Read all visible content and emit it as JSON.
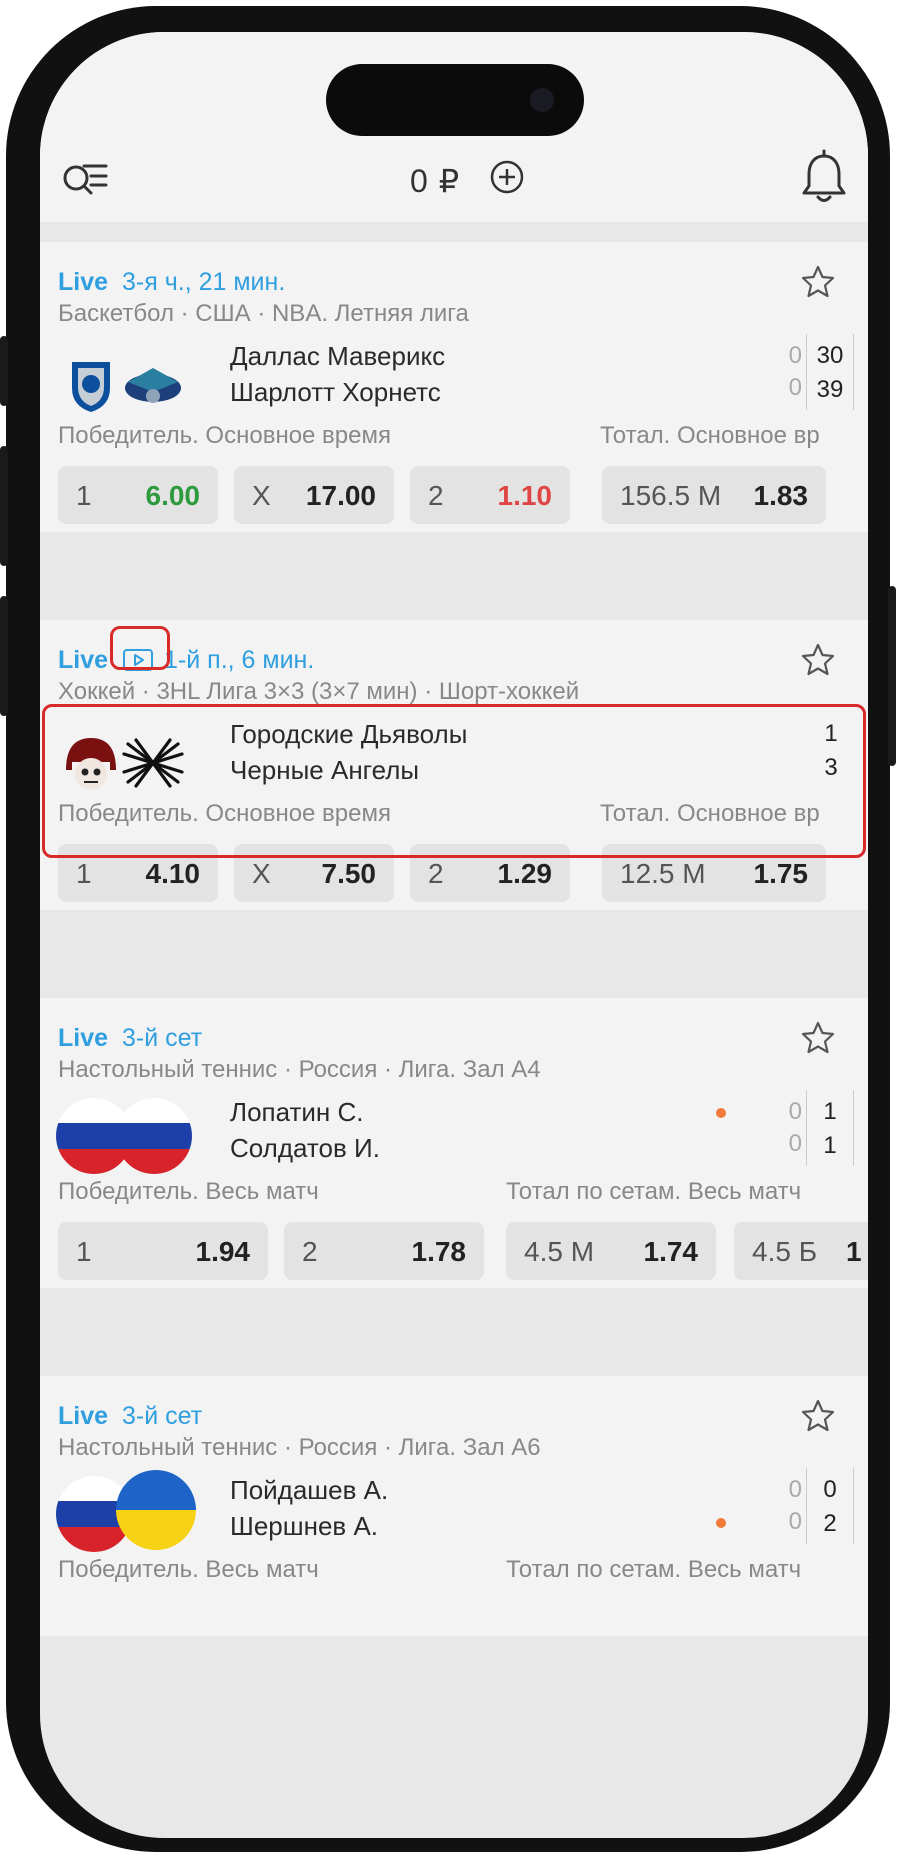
{
  "header": {
    "balance": "0 ₽"
  },
  "events": [
    {
      "live": "Live",
      "period": "3-я ч., 21 мин.",
      "league": "Баскетбол · США · NBA. Летняя лига",
      "team1": "Даллас Маверикс",
      "team2": "Шарлотт Хорнетс",
      "game1": "0",
      "game2": "0",
      "score1": "30",
      "score2": "39",
      "market1": "Победитель. Основное время",
      "market2": "Тотал. Основное вр",
      "odds": [
        {
          "k": "1",
          "v": "6.00"
        },
        {
          "k": "X",
          "v": "17.00"
        },
        {
          "k": "2",
          "v": "1.10"
        },
        {
          "k": "156.5 М",
          "v": "1.83"
        }
      ]
    },
    {
      "live": "Live",
      "period": "1-й п., 6 мин.",
      "league": "Хоккей · 3HL Лига 3×3 (3×7 мин) · Шорт-хоккей",
      "team1": "Городские Дьяволы",
      "team2": "Черные Ангелы",
      "score1": "1",
      "score2": "3",
      "market1": "Победитель. Основное время",
      "market2": "Тотал. Основное вр",
      "odds": [
        {
          "k": "1",
          "v": "4.10"
        },
        {
          "k": "X",
          "v": "7.50"
        },
        {
          "k": "2",
          "v": "1.29"
        },
        {
          "k": "12.5 М",
          "v": "1.75"
        }
      ]
    },
    {
      "live": "Live",
      "period": "3-й сет",
      "league": "Настольный теннис · Россия · Лига. Зал А4",
      "team1": "Лопатин С.",
      "team2": "Солдатов И.",
      "game1": "0",
      "game2": "0",
      "score1": "1",
      "score2": "1",
      "market1": "Победитель. Весь матч",
      "market2": "Тотал по сетам. Весь матч",
      "odds": [
        {
          "k": "1",
          "v": "1.94"
        },
        {
          "k": "2",
          "v": "1.78"
        },
        {
          "k": "4.5 М",
          "v": "1.74"
        },
        {
          "k": "4.5 Б",
          "v": "1"
        }
      ]
    },
    {
      "live": "Live",
      "period": "3-й сет",
      "league": "Настольный теннис · Россия · Лига. Зал А6",
      "team1": "Пойдашев А.",
      "team2": "Шершнев А.",
      "game1": "0",
      "game2": "0",
      "score1": "0",
      "score2": "2",
      "market1": "Победитель. Весь матч",
      "market2": "Тотал по сетам. Весь матч"
    }
  ],
  "colors": {
    "live": "#2f9fe0",
    "odd_up": "#2e9a3e",
    "odd_down": "#e04545",
    "highlight": "#d92a2a",
    "serve": "#f07a3a"
  }
}
